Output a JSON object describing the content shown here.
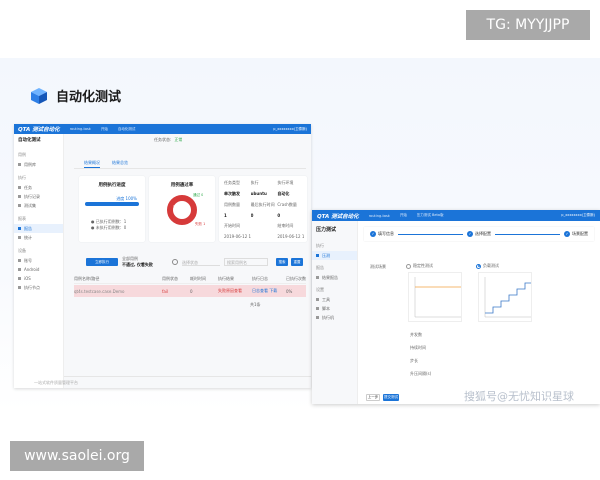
{
  "overlay": {
    "tg_label": "TG: MYYJJPP",
    "site_label": "www.saolei.org",
    "watermark": "搜狐号@无忧知识星球"
  },
  "slide": {
    "title": "自动化测试",
    "title_icon": "cube-icon",
    "accent_color": "#1b74d8"
  },
  "win1": {
    "logo": "QTA 测试自动化",
    "top_tabs": [
      "routing-task",
      "开始",
      "自动化测试"
    ],
    "user": "p_xxxxxxxx(卫泰斯)",
    "side_title": "自动化测试",
    "side_sections": [
      {
        "label": "用例",
        "items": [
          {
            "label": "用例库",
            "active": false
          }
        ]
      },
      {
        "label": "执行",
        "items": [
          {
            "label": "任务",
            "active": false
          },
          {
            "label": "执行记录",
            "active": false
          },
          {
            "label": "测试集",
            "active": false
          }
        ]
      },
      {
        "label": "报表",
        "items": [
          {
            "label": "报告",
            "active": true
          },
          {
            "label": "统计",
            "active": false
          }
        ]
      },
      {
        "label": "设备",
        "items": [
          {
            "label": "账号",
            "active": false
          },
          {
            "label": "Android",
            "active": false
          },
          {
            "label": "iOS",
            "active": false
          },
          {
            "label": "执行节点",
            "active": false
          }
        ]
      }
    ],
    "header_status_label": "任务状态:",
    "header_status_value": "正常",
    "subtabs": [
      {
        "label": "结果概况",
        "active": true
      },
      {
        "label": "结果总览",
        "active": false
      }
    ],
    "card_exec": {
      "title": "用例执行进度",
      "progress_label": "进度 100%",
      "progress": 1.0,
      "legend": [
        "● 已执行用例数：1",
        "● 未执行用例数：0"
      ]
    },
    "card_pass": {
      "title": "用例通过率",
      "center_label": "通过率",
      "center_value": "0%",
      "pass_label": "通过 0",
      "fail_label": "失败 1"
    },
    "card_info": {
      "rows": [
        [
          "任务类型",
          "执行",
          "执行环境"
        ],
        [
          "单次触发",
          "ubuntu",
          "自动化"
        ],
        [
          "用例数量",
          "最后执行时间",
          "Crash数量"
        ],
        [
          "1",
          "0",
          "0"
        ],
        [
          "开始时间",
          "",
          "结束时间"
        ],
        [
          "2019-06-12 10:38",
          "",
          "2019-06-12 10:39"
        ]
      ]
    },
    "toolbar": {
      "run_button": "立即执行",
      "filter_title": "全部用例",
      "filter_sub": "不通过, 仅看失败",
      "select_placeholder": "选择状态",
      "search_placeholder": "搜索用例名",
      "btn_search": "搜索",
      "btn_reset": "重置"
    },
    "table": {
      "headers": [
        "用例名称/路径",
        "用例状态",
        "耗时时间",
        "执行结果",
        "执行日志",
        "已执行次数"
      ],
      "rows": [
        [
          "qt4s.testcase.case.Demo",
          "fail",
          "0",
          "失败原因查看",
          "日志查看 下载",
          "0%"
        ]
      ]
    },
    "pager": "共1条",
    "footer": "一站式软件质量管理平台"
  },
  "win2": {
    "logo": "QTA 测试自动化",
    "top_tabs": [
      "routing-task",
      "开始",
      "压力测试 Beta版"
    ],
    "user": "p_xxxxxxxx(卫泰斯)",
    "side_title": "压力测试",
    "side_sections": [
      {
        "label": "执行",
        "items": [
          {
            "label": "压测",
            "active": true
          }
        ]
      },
      {
        "label": "报告",
        "items": [
          {
            "label": "结果报告",
            "active": false
          }
        ]
      },
      {
        "label": "设置",
        "items": [
          {
            "label": "工具",
            "active": false
          },
          {
            "label": "脚本",
            "active": false
          },
          {
            "label": "执行机",
            "active": false
          }
        ]
      }
    ],
    "steps": [
      "填写信息",
      "选择配置",
      "场景配置"
    ],
    "form": {
      "mode_label": "测试场景",
      "options": [
        "稳定性测试",
        "负载测试"
      ],
      "selected": 1,
      "fields": [
        "并发数",
        "持续时间",
        "步长",
        "升压间隔(s)"
      ]
    },
    "btn_prev": "上一步",
    "btn_submit": "提交测试"
  }
}
